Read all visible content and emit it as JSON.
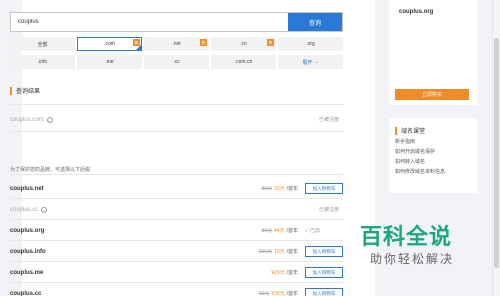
{
  "search": {
    "query": "couplus",
    "button_label": "查询"
  },
  "suffixes": [
    {
      "label": "全部",
      "active": false,
      "hot": false
    },
    {
      "label": ".com",
      "active": true,
      "hot": true
    },
    {
      "label": ".net",
      "active": false,
      "hot": true
    },
    {
      "label": ".cn",
      "active": false,
      "hot": true
    },
    {
      "label": ".org",
      "active": false,
      "hot": false
    },
    {
      "label": ".info",
      "active": false,
      "hot": false
    },
    {
      "label": ".me",
      "active": false,
      "hot": false
    },
    {
      "label": ".cc",
      "active": false,
      "hot": false
    },
    {
      "label": ".com.cn",
      "active": false,
      "hot": false
    },
    {
      "label": "展开",
      "active": false,
      "hot": false,
      "more": true
    }
  ],
  "hot_badge": "热",
  "results": {
    "title": "查询结果",
    "primary": {
      "name": "couplus",
      "tld": ".com",
      "status": "已被注册"
    },
    "hint": "为了保护您的品牌，可选择以下后缀",
    "cart_label": "加入购物车",
    "price_unit": "/首年",
    "rows": [
      {
        "name": "couplus",
        "tld": ".net",
        "orig": "88元",
        "price": "33元",
        "status": "",
        "taken": false,
        "selected": false
      },
      {
        "name": "couplus",
        "tld": ".cc",
        "orig": "",
        "price": "",
        "status": "已被注册",
        "taken": true,
        "selected": false
      },
      {
        "name": "couplus",
        "tld": ".org",
        "orig": "88元",
        "price": "44元",
        "status": "已加",
        "taken": false,
        "selected": true
      },
      {
        "name": "couplus",
        "tld": ".info",
        "orig": "266元",
        "price": "19元",
        "status": "",
        "taken": false,
        "selected": false
      },
      {
        "name": "couplus",
        "tld": ".me",
        "orig": "",
        "price": "¥29元",
        "status": "",
        "taken": false,
        "selected": false
      },
      {
        "name": "couplus",
        "tld": ".cc",
        "orig": "68元",
        "price": "¥39元",
        "status": "",
        "taken": false,
        "selected": false
      }
    ]
  },
  "sidebar": {
    "selected_domain": {
      "name": "couplus",
      "tld": ".org"
    },
    "register_button": "立即购买",
    "guide_title": "域名课堂",
    "guide_links": [
      "新手指南",
      "如何开启域名保护",
      "如何转入域名",
      "如何修改域名资料信息"
    ]
  },
  "watermark": {
    "line1": "百科全说",
    "line2": "助你轻松解决"
  }
}
